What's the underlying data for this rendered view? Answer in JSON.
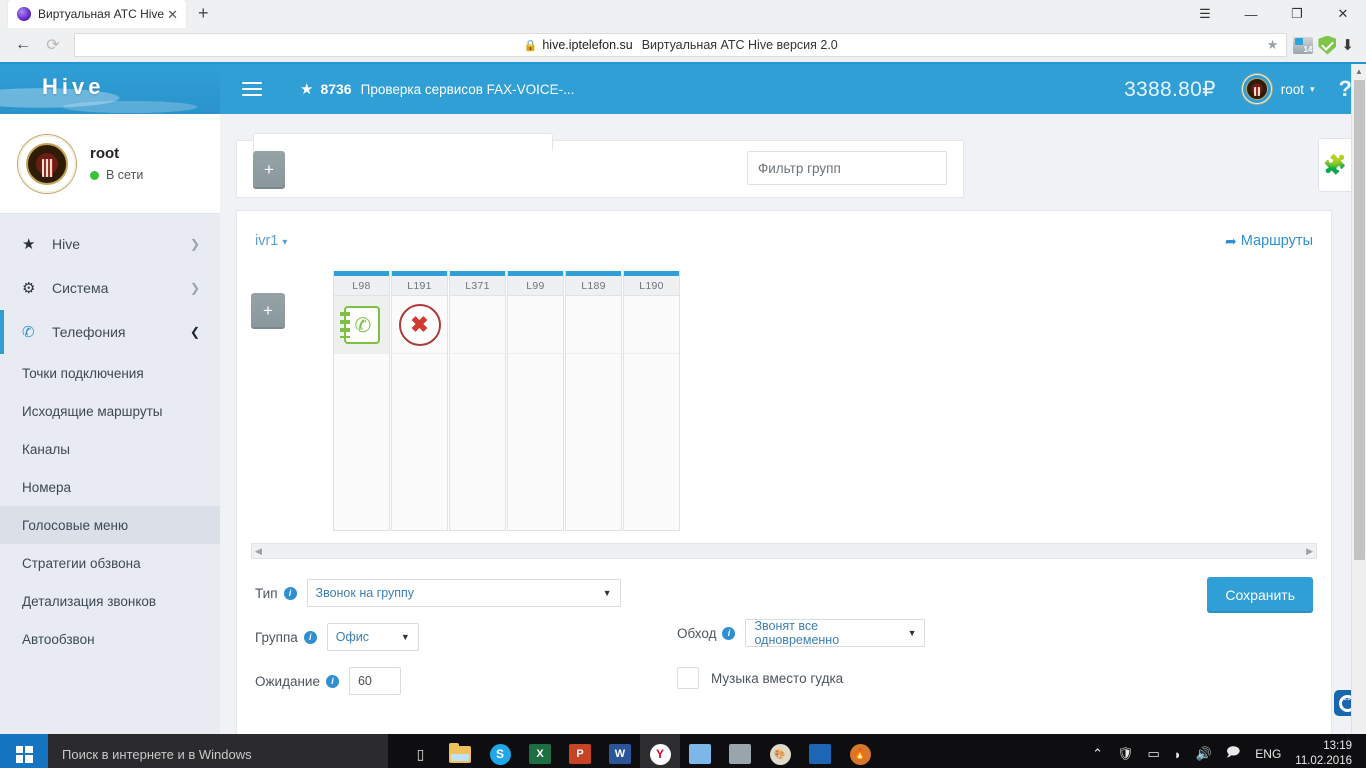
{
  "browser": {
    "tab_title": "Виртуальная АТС Hive ве",
    "tab_close": "✕",
    "new_tab": "+",
    "back": "←",
    "reload": "⟳",
    "url_host": "hive.iptelefon.su",
    "url_title": "Виртуальная АТС Hive версия 2.0",
    "star": "★",
    "win_menu": "☰",
    "win_min": "—",
    "win_max": "❐",
    "win_close": "✕",
    "ext_badge_count": "14",
    "download": "⬇"
  },
  "sidebar": {
    "brand": "Hive",
    "profile": {
      "name": "root",
      "status": "В сети"
    },
    "nav": [
      {
        "label": "Hive",
        "icon": "star-icon",
        "glyph": "★",
        "chevron": "❯",
        "active": false
      },
      {
        "label": "Система",
        "icon": "gears-icon",
        "glyph": "⚙",
        "chevron": "❯",
        "active": false
      },
      {
        "label": "Телефония",
        "icon": "phone-icon",
        "glyph": "✆",
        "chevron": "❯",
        "active": true
      }
    ],
    "sub_items": [
      {
        "label": "Точки подключения",
        "selected": false
      },
      {
        "label": "Исходящие маршруты",
        "selected": false
      },
      {
        "label": "Каналы",
        "selected": false
      },
      {
        "label": "Номера",
        "selected": false
      },
      {
        "label": "Голосовые меню",
        "selected": true
      },
      {
        "label": "Стратегии обзвона",
        "selected": false
      },
      {
        "label": "Детализация звонков",
        "selected": false
      },
      {
        "label": "Автообзвон",
        "selected": false
      }
    ]
  },
  "topbar": {
    "burger": "menu-icon",
    "star": "★",
    "number": "8736",
    "title": "Проверка сервисов FAX-VOICE-...",
    "balance": "3388.80₽",
    "user": "root",
    "caret": "▾",
    "help": "?"
  },
  "toolbar": {
    "add_button": "+",
    "filter_placeholder": "Фильтр групп",
    "filter_value": ""
  },
  "board": {
    "ivr_name": "ivr1",
    "ivr_caret": "▾",
    "routes_label": "Маршруты",
    "routes_icon": "➦",
    "add_button": "+",
    "columns": [
      {
        "header": "L98",
        "cell_icon": "phonebook-icon"
      },
      {
        "header": "L191",
        "cell_icon": "red-x-icon"
      },
      {
        "header": "L371",
        "cell_icon": ""
      },
      {
        "header": "L99",
        "cell_icon": ""
      },
      {
        "header": "L189",
        "cell_icon": ""
      },
      {
        "header": "L190",
        "cell_icon": ""
      }
    ],
    "scroll_left": "◀",
    "scroll_right": "▶"
  },
  "form": {
    "type_label": "Тип",
    "type_value": "Звонок на группу",
    "group_label": "Группа",
    "group_value": "Офис",
    "wait_label": "Ожидание",
    "wait_value": "60",
    "bypass_label": "Обход",
    "bypass_value": "Звонят все одновременно",
    "music_label": "Музыка вместо гудка",
    "music_checked": false,
    "save_label": "Сохранить",
    "info_glyph": "i",
    "caret": "▼"
  },
  "widgets": {
    "puzzle": "puzzle-piece-icon",
    "teamviewer": "teamviewer-icon"
  },
  "taskbar": {
    "search_placeholder": "Поиск в интернете и в Windows",
    "task_view": "▯",
    "apps": [
      {
        "name": "file-explorer",
        "label": ""
      },
      {
        "name": "skype",
        "label": "S"
      },
      {
        "name": "excel",
        "label": "X"
      },
      {
        "name": "powerpoint",
        "label": "P"
      },
      {
        "name": "word",
        "label": "W"
      },
      {
        "name": "yandex-browser",
        "label": "Y"
      },
      {
        "name": "outlook",
        "label": ""
      },
      {
        "name": "monitor-app",
        "label": ""
      },
      {
        "name": "paint",
        "label": ""
      },
      {
        "name": "blue-app",
        "label": ""
      },
      {
        "name": "flame-app",
        "label": ""
      }
    ],
    "tray": {
      "chevron": "⌃",
      "security": "🛡",
      "battery": "▭",
      "network": "📶",
      "volume": "🔊",
      "action_center": "🗨",
      "language": "ENG",
      "time": "13:19",
      "date": "11.02.2016"
    }
  }
}
